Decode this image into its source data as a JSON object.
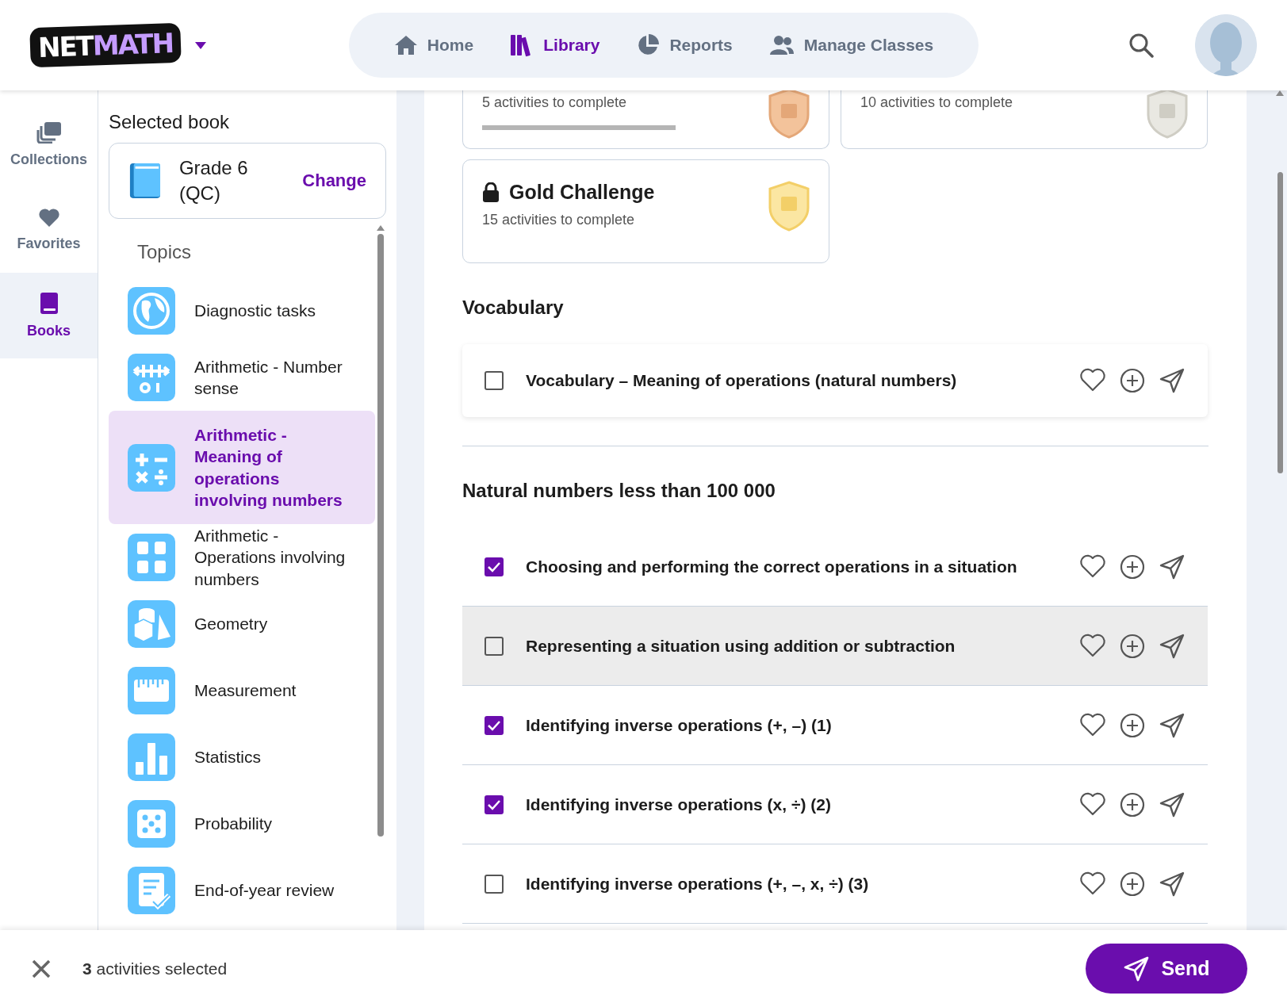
{
  "header": {
    "logo": {
      "part_1": "NET",
      "part_2": "MATH"
    },
    "nav": [
      {
        "label": "Home",
        "selected": false
      },
      {
        "label": "Library",
        "selected": true
      },
      {
        "label": "Reports",
        "selected": false
      },
      {
        "label": "Manage Classes",
        "selected": false
      }
    ]
  },
  "rail": [
    {
      "label": "Collections",
      "selected": false
    },
    {
      "label": "Favorites",
      "selected": false
    },
    {
      "label": "Books",
      "selected": true
    }
  ],
  "book_panel": {
    "heading": "Selected book",
    "book_title": "Grade 6 (QC)",
    "change_link": "Change",
    "topics_heading": "Topics",
    "topics": [
      {
        "label": "Diagnostic tasks",
        "selected": false
      },
      {
        "label": "Arithmetic - Number sense",
        "selected": false
      },
      {
        "label": "Arithmetic - Meaning of operations involving numbers",
        "selected": true
      },
      {
        "label": "Arithmetic - Operations involving numbers",
        "selected": false
      },
      {
        "label": "Geometry",
        "selected": false
      },
      {
        "label": "Measurement",
        "selected": false
      },
      {
        "label": "Statistics",
        "selected": false
      },
      {
        "label": "Probability",
        "selected": false
      },
      {
        "label": "End-of-year review",
        "selected": false
      }
    ]
  },
  "challenges": [
    {
      "kind": "bronze",
      "subtitle": "5 activities to complete",
      "progress": {
        "level": 1
      }
    },
    {
      "kind": "silver",
      "subtitle": "10 activities to complete"
    },
    {
      "kind": "gold",
      "locked": true,
      "title": "Gold Challenge",
      "subtitle": "15 activities to complete"
    }
  ],
  "sections": [
    {
      "heading": "Vocabulary",
      "kind": "card",
      "activities": [
        {
          "title": "Vocabulary – Meaning of operations (natural numbers)",
          "checked": false,
          "hovered": false
        }
      ]
    },
    {
      "heading": "Natural numbers less than 100 000",
      "kind": "list",
      "activities": [
        {
          "title": "Choosing and performing the correct operations in a situation",
          "checked": true,
          "hovered": false
        },
        {
          "title": "Representing a situation using addition or subtraction",
          "checked": false,
          "hovered": true
        },
        {
          "title": "Identifying inverse operations (+, –) (1)",
          "checked": true,
          "hovered": false
        },
        {
          "title": "Identifying inverse operations (x, ÷) (2)",
          "checked": true,
          "hovered": false
        },
        {
          "title": "Identifying inverse operations (+, –, x, ÷) (3)",
          "checked": false,
          "hovered": false
        }
      ]
    }
  ],
  "footer": {
    "selection_text": "**3** activities selected",
    "send_button": "Send"
  }
}
